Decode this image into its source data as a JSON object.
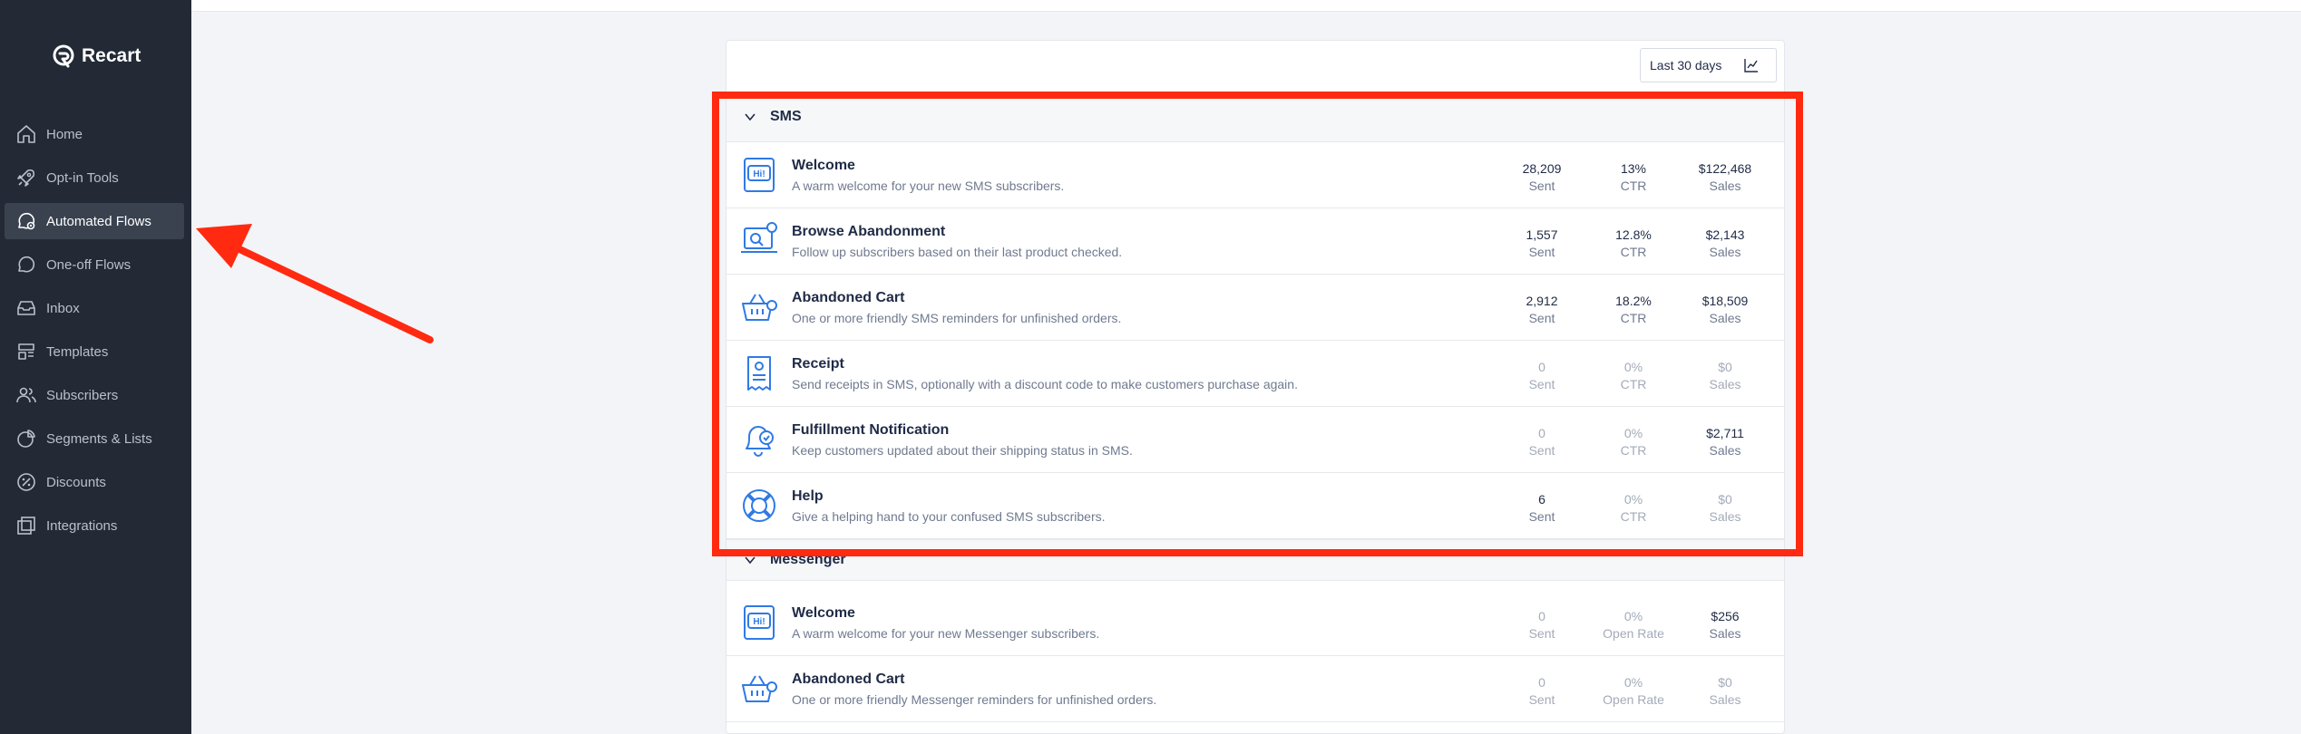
{
  "app": {
    "name": "Recart"
  },
  "sidebar": {
    "items": [
      {
        "label": "Home",
        "icon": "home-icon"
      },
      {
        "label": "Opt-in Tools",
        "icon": "rocket-icon"
      },
      {
        "label": "Automated Flows",
        "icon": "automation-icon",
        "active": true
      },
      {
        "label": "One-off Flows",
        "icon": "chat-icon"
      },
      {
        "label": "Inbox",
        "icon": "inbox-icon"
      },
      {
        "label": "Templates",
        "icon": "templates-icon"
      },
      {
        "label": "Subscribers",
        "icon": "users-icon"
      },
      {
        "label": "Segments & Lists",
        "icon": "segments-icon"
      },
      {
        "label": "Discounts",
        "icon": "discount-icon"
      },
      {
        "label": "Integrations",
        "icon": "integrations-icon"
      }
    ]
  },
  "date_filter": {
    "label": "Last 30 days"
  },
  "sections": [
    {
      "title": "SMS",
      "rows": [
        {
          "title": "Welcome",
          "desc": "A warm welcome for your new SMS subscribers.",
          "icon": "hi-chat-icon",
          "m1": {
            "value": "28,209",
            "label": "Sent"
          },
          "m2": {
            "value": "13%",
            "label": "CTR"
          },
          "m3": {
            "value": "$122,468",
            "label": "Sales"
          }
        },
        {
          "title": "Browse Abandonment",
          "desc": "Follow up subscribers based on their last product checked.",
          "icon": "laptop-search-icon",
          "m1": {
            "value": "1,557",
            "label": "Sent"
          },
          "m2": {
            "value": "12.8%",
            "label": "CTR"
          },
          "m3": {
            "value": "$2,143",
            "label": "Sales"
          }
        },
        {
          "title": "Abandoned Cart",
          "desc": "One or more friendly SMS reminders for unfinished orders.",
          "icon": "basket-icon",
          "m1": {
            "value": "2,912",
            "label": "Sent"
          },
          "m2": {
            "value": "18.2%",
            "label": "CTR"
          },
          "m3": {
            "value": "$18,509",
            "label": "Sales"
          }
        },
        {
          "title": "Receipt",
          "desc": "Send receipts in SMS, optionally with a discount code to make customers purchase again.",
          "icon": "receipt-icon",
          "m1": {
            "value": "0",
            "label": "Sent"
          },
          "m2": {
            "value": "0%",
            "label": "CTR"
          },
          "m3": {
            "value": "$0",
            "label": "Sales"
          }
        },
        {
          "title": "Fulfillment Notification",
          "desc": "Keep customers updated about their shipping status in SMS.",
          "icon": "bell-check-icon",
          "m1": {
            "value": "0",
            "label": "Sent"
          },
          "m2": {
            "value": "0%",
            "label": "CTR"
          },
          "m3": {
            "value": "$2,711",
            "label": "Sales"
          }
        },
        {
          "title": "Help",
          "desc": "Give a helping hand to your confused SMS subscribers.",
          "icon": "lifebuoy-icon",
          "m1": {
            "value": "6",
            "label": "Sent"
          },
          "m2": {
            "value": "0%",
            "label": "CTR"
          },
          "m3": {
            "value": "$0",
            "label": "Sales"
          }
        }
      ]
    },
    {
      "title": "Messenger",
      "rows": [
        {
          "title": "Welcome",
          "desc": "A warm welcome for your new Messenger subscribers.",
          "icon": "hi-chat-icon",
          "m1": {
            "value": "0",
            "label": "Sent"
          },
          "m2": {
            "value": "0%",
            "label": "Open Rate"
          },
          "m3": {
            "value": "$256",
            "label": "Sales"
          }
        },
        {
          "title": "Abandoned Cart",
          "desc": "One or more friendly Messenger reminders for unfinished orders.",
          "icon": "basket-icon",
          "m1": {
            "value": "0",
            "label": "Sent"
          },
          "m2": {
            "value": "0%",
            "label": "Open Rate"
          },
          "m3": {
            "value": "$0",
            "label": "Sales"
          }
        }
      ]
    }
  ],
  "colors": {
    "sidebar": "#232a36",
    "accent_blue": "#2f7ae5",
    "annotation_red": "#ff2a10"
  }
}
